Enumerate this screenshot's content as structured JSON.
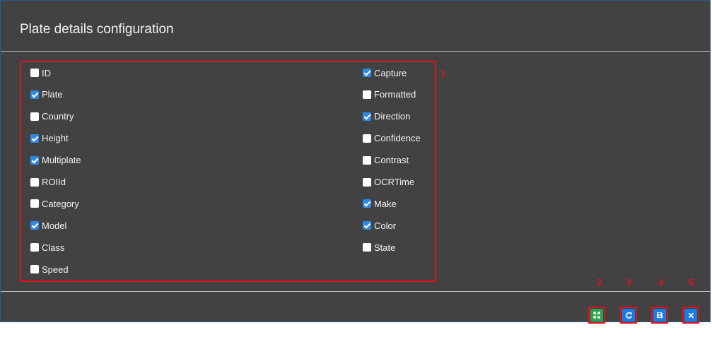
{
  "dialog": {
    "title": "Plate details configuration"
  },
  "fields": {
    "left": [
      {
        "label": "ID",
        "checked": false
      },
      {
        "label": "Plate",
        "checked": true
      },
      {
        "label": "Country",
        "checked": false
      },
      {
        "label": "Height",
        "checked": true
      },
      {
        "label": "Multiplate",
        "checked": true
      },
      {
        "label": "ROIId",
        "checked": false
      },
      {
        "label": "Category",
        "checked": false
      },
      {
        "label": "Model",
        "checked": true
      },
      {
        "label": "Class",
        "checked": false
      },
      {
        "label": "Speed",
        "checked": false
      }
    ],
    "right": [
      {
        "label": "Capture",
        "checked": true
      },
      {
        "label": "Formatted",
        "checked": false
      },
      {
        "label": "Direction",
        "checked": true
      },
      {
        "label": "Confidence",
        "checked": false
      },
      {
        "label": "Contrast",
        "checked": false
      },
      {
        "label": "OCRTime",
        "checked": false
      },
      {
        "label": "Make",
        "checked": true
      },
      {
        "label": "Color",
        "checked": true
      },
      {
        "label": "State",
        "checked": false
      }
    ]
  },
  "annotations": [
    "1",
    "2",
    "3",
    "4",
    "5"
  ],
  "buttons": [
    {
      "icon": "expand-icon",
      "color": "#2ea14f"
    },
    {
      "icon": "refresh-icon",
      "color": "#1e7be6"
    },
    {
      "icon": "save-icon",
      "color": "#1e7be6"
    },
    {
      "icon": "close-icon",
      "color": "#1e7be6"
    }
  ],
  "colors": {
    "annotation": "#e0131c",
    "dialog_bg": "#424242",
    "checkbox_checked": "#2f8ae5"
  }
}
